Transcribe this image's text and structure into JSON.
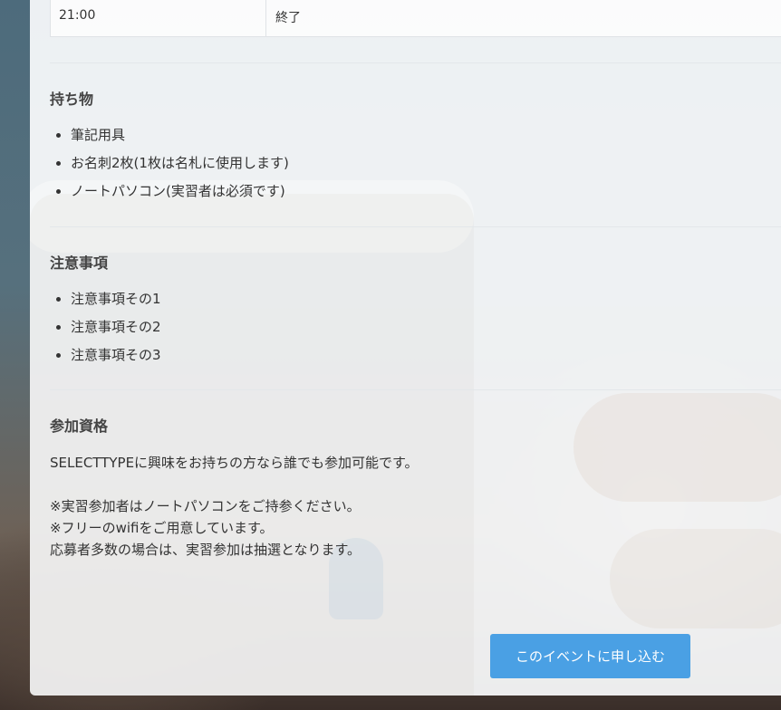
{
  "schedule_row": {
    "time": "21:00",
    "description": "終了"
  },
  "belongings": {
    "heading": "持ち物",
    "items": [
      "筆記用具",
      "お名刺2枚(1枚は名札に使用します)",
      "ノートパソコン(実習者は必須です)"
    ]
  },
  "notes": {
    "heading": "注意事項",
    "items": [
      "注意事項その1",
      "注意事項その2",
      "注意事項その3"
    ]
  },
  "eligibility": {
    "heading": "参加資格",
    "intro": "SELECTTYPEに興味をお持ちの方なら誰でも参加可能です。",
    "lines": [
      "※実習参加者はノートパソコンをご持参ください。",
      "※フリーのwifiをご用意しています。",
      "応募者多数の場合は、実習参加は抽選となります。"
    ]
  },
  "apply_button": {
    "label": "このイベントに申し込む"
  },
  "colors": {
    "button": "#4aa0e4",
    "text": "#333333",
    "panel": "#fafbfc"
  }
}
